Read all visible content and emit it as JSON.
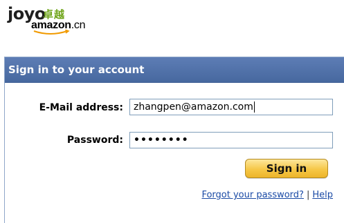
{
  "logo": {
    "brand": "joyo",
    "cn_text": "卓越",
    "amazon": "amazon",
    "tld": ".cn"
  },
  "panel": {
    "title": "Sign in to your account"
  },
  "form": {
    "email_label": "E-Mail address:",
    "email_value": "zhangpen@amazon.com",
    "password_label": "Password:",
    "password_value": "••••••••",
    "signin_label": "Sign in"
  },
  "links": {
    "forgot_password": "Forgot your password?",
    "separator": "|",
    "help": "Help"
  },
  "colors": {
    "header_bg": "#4e70a8",
    "button_bg": "#f6c747",
    "link": "#1a4aa5",
    "logo_green": "#6fa41a"
  }
}
